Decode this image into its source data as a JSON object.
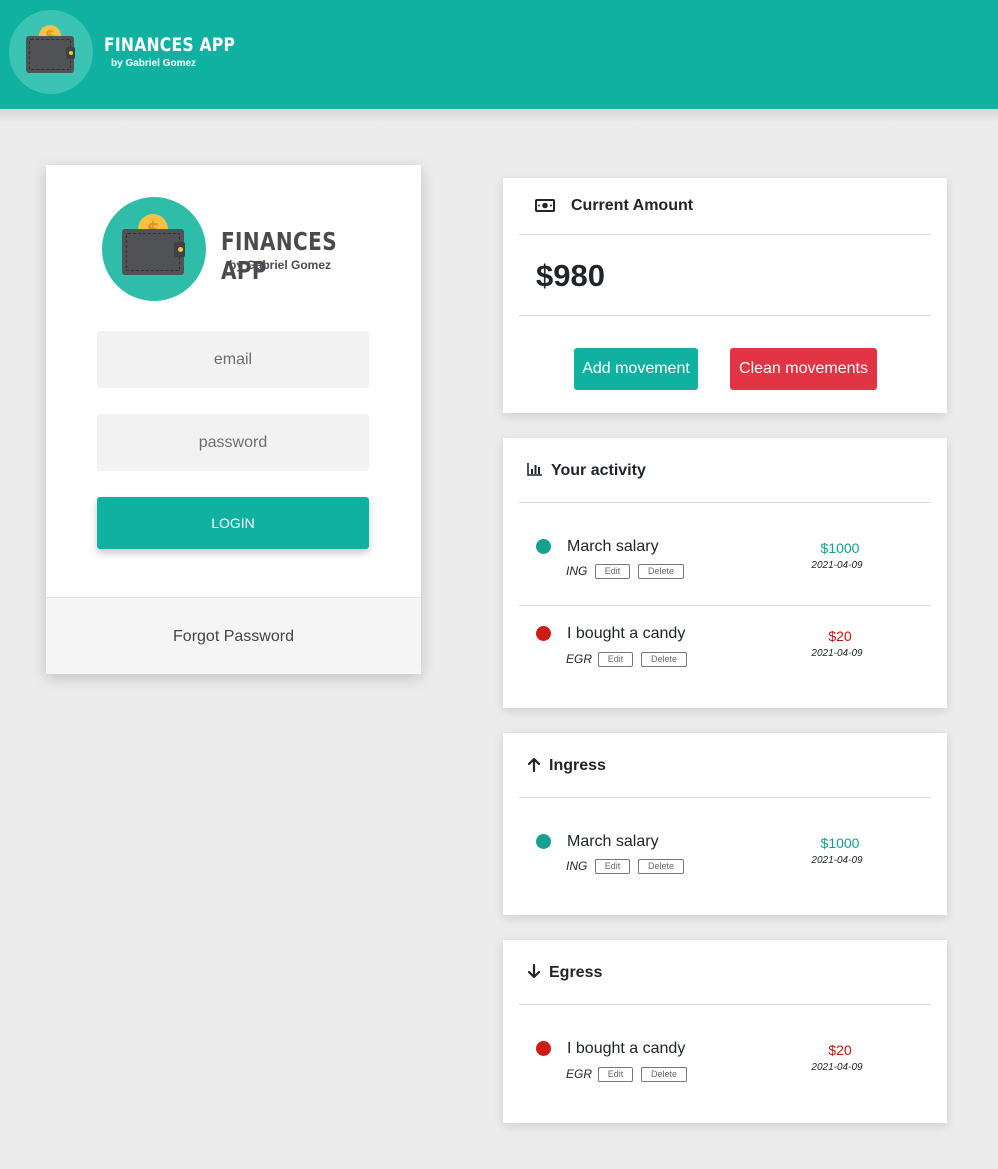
{
  "header": {
    "title": "FINANCES APP",
    "subtitle": "by Gabriel Gomez"
  },
  "login": {
    "title": "FINANCES APP",
    "subtitle": "by Gabriel Gomez",
    "email_placeholder": "email",
    "password_placeholder": "password",
    "login_label": "LOGIN",
    "forgot_label": "Forgot Password",
    "logo_coin": "$"
  },
  "current_amount": {
    "title": "Current Amount",
    "value": "$980",
    "add_label": "Add movement",
    "clean_label": "Clean movements"
  },
  "activity": {
    "title": "Your activity",
    "items": [
      {
        "description": "March salary",
        "type": "ING",
        "amount": "$1000",
        "date": "2021-04-09",
        "edit": "Edit",
        "delete": "Delete"
      },
      {
        "description": "I bought a candy",
        "type": "EGR",
        "amount": "$20",
        "date": "2021-04-09",
        "edit": "Edit",
        "delete": "Delete"
      }
    ]
  },
  "ingress": {
    "title": "Ingress",
    "items": [
      {
        "description": "March salary",
        "type": "ING",
        "amount": "$1000",
        "date": "2021-04-09",
        "edit": "Edit",
        "delete": "Delete"
      }
    ]
  },
  "egress": {
    "title": "Egress",
    "items": [
      {
        "description": "I bought a candy",
        "type": "EGR",
        "amount": "$20",
        "date": "2021-04-09",
        "edit": "Edit",
        "delete": "Delete"
      }
    ]
  },
  "colors": {
    "primary": "#10b1a1",
    "danger": "#e33445",
    "income": "#16a08f",
    "expense": "#cc1f12"
  },
  "icons": {
    "header_logo": "wallet-coin-icon",
    "current_amount": "money-bill-icon",
    "activity": "bar-chart-icon",
    "ingress": "arrow-up-icon",
    "egress": "arrow-down-icon"
  }
}
